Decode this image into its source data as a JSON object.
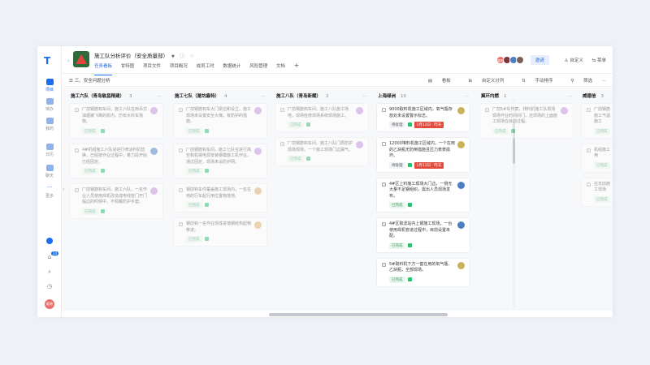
{
  "app": {
    "logo": "T"
  },
  "rail": {
    "items": [
      {
        "label": "项目",
        "icon": "project-icon"
      },
      {
        "label": "待办",
        "icon": "todo-icon"
      },
      {
        "label": "我的",
        "icon": "my-icon"
      },
      {
        "label": "日历",
        "icon": "calendar-icon"
      },
      {
        "label": "聊天",
        "icon": "chat-icon"
      },
      {
        "label": "更多",
        "icon": "more-icon"
      }
    ],
    "notification_count": "24",
    "me_avatar": "昵称"
  },
  "header": {
    "title": "施工队分析评价（安全质量部）",
    "tabs": [
      "任务看板",
      "甘特图",
      "项目文件",
      "项目概况",
      "成员工时",
      "数据统计",
      "风险管理",
      "文档"
    ],
    "add_tab": "+",
    "invite": "邀请",
    "customize": "自定义",
    "menu": "菜单",
    "members": [
      {
        "initials": "昵称",
        "color": "#e8736c"
      },
      {
        "initials": "",
        "color": "#7a3a3a"
      },
      {
        "initials": "",
        "color": "#4a7fc1"
      },
      {
        "initials": "",
        "color": "#7b5e54"
      }
    ]
  },
  "toolbar": {
    "view_label": "三、安全问题分析",
    "board": "看板",
    "custom_group": "自定义分列",
    "manual_sort": "手动排序",
    "filter": "筛选",
    "more": "···"
  },
  "columns": [
    {
      "name": "施工六队（青岛敏昌精建）",
      "count": "3",
      "faded": true,
      "cards": [
        {
          "text": "厂前钢筋钩车间，施工六队在用吊式油烟被飞离的机内，仍有水科车落物。",
          "done": true,
          "avatar_color": "#c58de0"
        },
        {
          "text": "4#机组施工六队进进行喷涂料机替换，已经按作业过程中，着力段开始已经固定。",
          "done": true,
          "avatar_color": "#4a7fc1"
        },
        {
          "text": "厂前钢筋钩车间，施工六队，一名作业人员使用焊机改造成电线管门开门临边的时候中，不佩戴防护手套。",
          "done": true,
          "avatar_color": "#c58de0"
        }
      ]
    },
    {
      "name": "施工七队（潍坊鑫特）",
      "count": "4",
      "faded": true,
      "cards": [
        {
          "text": "厂前钢筋钩车大门梁边和设立，施工现场未设置安全大梯，有防护的措施。",
          "done": true,
          "avatar_color": "#c58de0"
        },
        {
          "text": "厂前钢筋钩车间，施工七队在进行高空和机械电源安装钢模施工机作业，通过固定，现场未设防护网。",
          "done": true,
          "avatar_color": "#c58de0"
        },
        {
          "text": "钢前钩车件覆盖施工现场内，一名在用的行车起行用位置物落地。",
          "done": true,
          "avatar_color": "#e0b06c"
        },
        {
          "text": "钢前钩一名作业现成进墙钢结构起物移进。",
          "done": true,
          "avatar_color": "#e0b06c"
        }
      ]
    },
    {
      "name": "施工八队（青岛新耀）",
      "count": "2",
      "faded": true,
      "cards": [
        {
          "text": "厂前钢筋钩车间，施工八队施工场地，现场检修现场系统现场施工。",
          "done": true,
          "avatar_color": "#c58de0"
        },
        {
          "text": "厂前钢筋钩车间，施工八队门局防护现场现场，一个施工现场门边漏气。",
          "done": true,
          "avatar_color": "#c58de0"
        }
      ]
    },
    {
      "name": "上海绿洲",
      "count": "10",
      "faded": false,
      "cards": [
        {
          "text": "9000取料机施工区域内，氧气瓶存放处未设置警示标志。",
          "done": false,
          "status": "待处理",
          "date": "1月12日 · 昨天",
          "avatar_color": "#c9b25a"
        },
        {
          "text": "12000堆料机施工区域内，一个在用的乙炔瓶无防倒措施且压力表表损坏。",
          "done": false,
          "status": "待处理",
          "date": "1月12日 · 昨天",
          "avatar_color": "#c9b25a"
        },
        {
          "text": "4#区上料施工现场大门边，一侧无大量不足钢组织，需出人员现场发布。",
          "done": true,
          "avatar_color": "#4a7fc1"
        },
        {
          "text": "4#区取滤站内上钢施工现场，一台使用焊机管道过程中，目前设置未配。",
          "done": true,
          "avatar_color": "#4a7fc1"
        },
        {
          "text": "5#取料机下方一套在用的氧气瓶、乙炔瓶，全部现场。",
          "done": true,
          "avatar_color": "#c9b25a"
        }
      ]
    },
    {
      "name": "冀环内燃",
      "count": "1",
      "faded": true,
      "cards": [
        {
          "text": "厂前5#车作案，排料机施工队现场现场作业时间间门，还现场的上面施工现场在目前过程。",
          "done": true,
          "avatar_color": "#c58de0"
        }
      ]
    },
    {
      "name": "威德信",
      "count": "3",
      "faded": true,
      "cards": [
        {
          "text": "厂前钢筋施工气温施工",
          "done": true,
          "avatar_color": ""
        },
        {
          "text": "机组施工用",
          "done": true,
          "avatar_color": ""
        },
        {
          "text": "在日前施工现场",
          "done": true,
          "avatar_color": ""
        }
      ]
    }
  ],
  "labels": {
    "done": "已完成"
  }
}
